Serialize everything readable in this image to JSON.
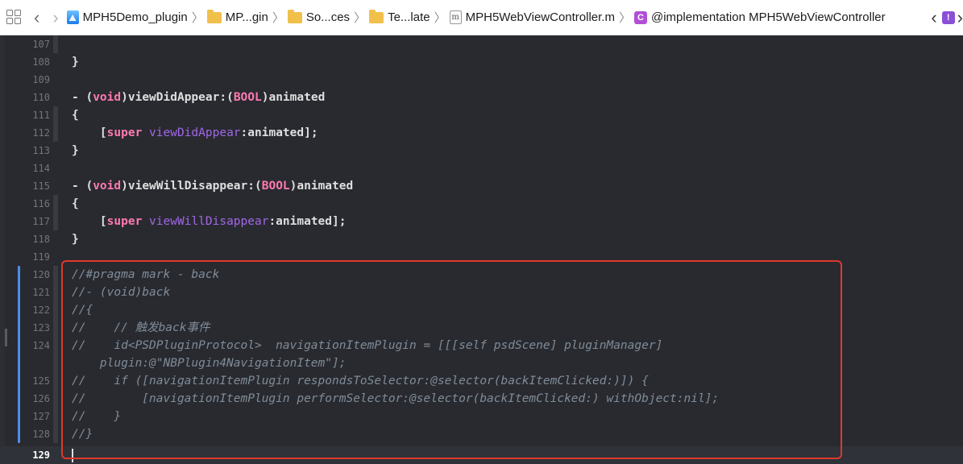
{
  "jumpbar": {
    "breadcrumbs": [
      {
        "label": "MPH5Demo_plugin",
        "icon": "xcode-project-icon"
      },
      {
        "label": "MP...gin",
        "icon": "folder-icon"
      },
      {
        "label": "So...ces",
        "icon": "folder-icon"
      },
      {
        "label": "Te...late",
        "icon": "folder-icon"
      },
      {
        "label": "MPH5WebViewController.m",
        "icon": "objc-file-icon"
      },
      {
        "label": "@implementation MPH5WebViewController",
        "icon": "class-icon"
      }
    ],
    "m_glyph": "m",
    "c_glyph": "C",
    "issue_glyph": "!"
  },
  "editor": {
    "current_line": "129",
    "lines": [
      {
        "num": "107",
        "text": ""
      },
      {
        "num": "108",
        "text": "}"
      },
      {
        "num": "109",
        "text": ""
      },
      {
        "num": "110",
        "dash": "- ",
        "lparen": "(",
        "kw": "void",
        "rparen": ")",
        "sel": "viewDidAppear:",
        "lparen2": "(",
        "type": "BOOL",
        "rparen2": ")",
        "arg": "animated"
      },
      {
        "num": "111",
        "text": "{"
      },
      {
        "num": "112",
        "indent": "    ",
        "lb": "[",
        "kw": "super",
        "sp": " ",
        "method": "viewDidAppear",
        "rest": ":animated];"
      },
      {
        "num": "113",
        "text": "}"
      },
      {
        "num": "114",
        "text": ""
      },
      {
        "num": "115",
        "dash": "- ",
        "lparen": "(",
        "kw": "void",
        "rparen": ")",
        "sel": "viewWillDisappear:",
        "lparen2": "(",
        "type": "BOOL",
        "rparen2": ")",
        "arg": "animated"
      },
      {
        "num": "116",
        "text": "{"
      },
      {
        "num": "117",
        "indent": "    ",
        "lb": "[",
        "kw": "super",
        "sp": " ",
        "method": "viewWillDisappear",
        "rest": ":animated];"
      },
      {
        "num": "118",
        "text": "}"
      },
      {
        "num": "119",
        "text": ""
      },
      {
        "num": "120",
        "text": "//#pragma mark - back"
      },
      {
        "num": "121",
        "text": "//- (void)back"
      },
      {
        "num": "122",
        "text": "//{"
      },
      {
        "num": "123",
        "text": "//    // 触发back事件"
      },
      {
        "num": "124",
        "text": "//    id<PSDPluginProtocol>  navigationItemPlugin = [[[self psdScene] pluginManager]"
      },
      {
        "num": "",
        "text": "    plugin:@\"NBPlugin4NavigationItem\"];"
      },
      {
        "num": "125",
        "text": "//    if ([navigationItemPlugin respondsToSelector:@selector(backItemClicked:)]) {"
      },
      {
        "num": "126",
        "text": "//        [navigationItemPlugin performSelector:@selector(backItemClicked:) withObject:nil];"
      },
      {
        "num": "127",
        "text": "//    }"
      },
      {
        "num": "128",
        "text": "//}"
      },
      {
        "num": "129",
        "text": ""
      }
    ]
  },
  "colors": {
    "background": "#292a30",
    "keyword": "#ff7ab2",
    "type": "#dabaff",
    "method": "#a167e6",
    "comment": "#7f8c98",
    "annotation_box": "#e0382c",
    "change_bar": "#4a8fe7"
  }
}
